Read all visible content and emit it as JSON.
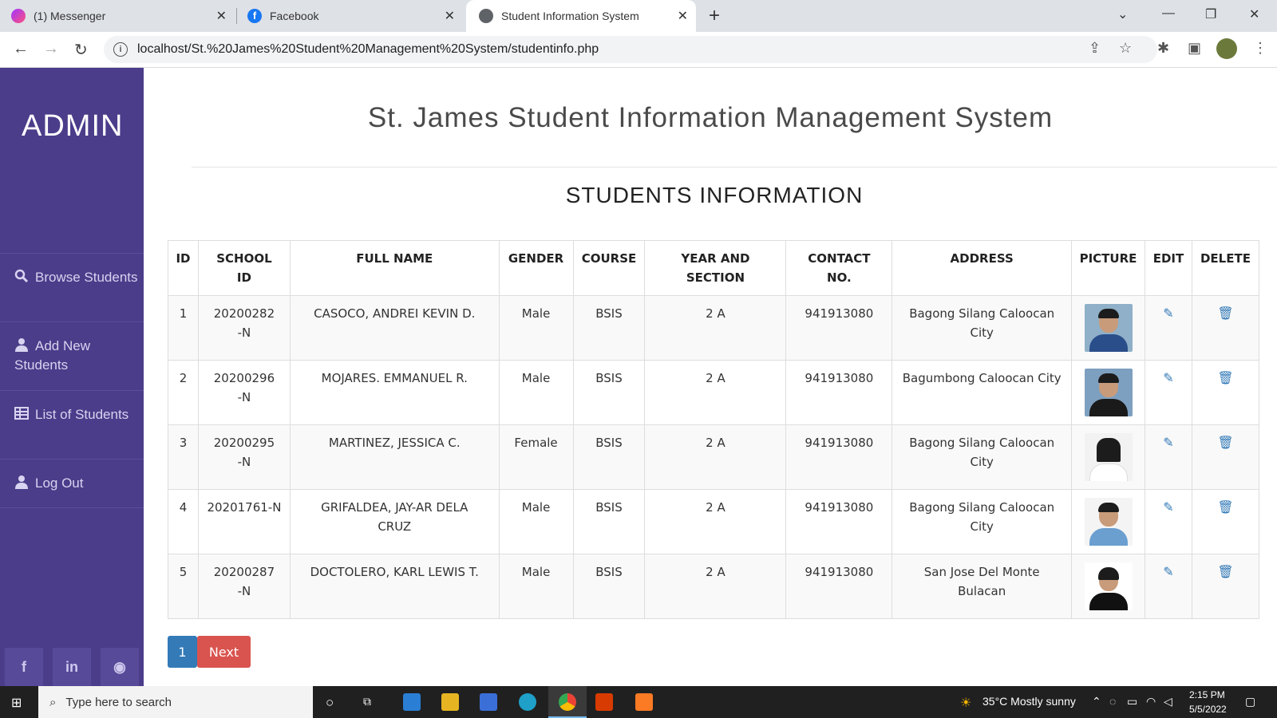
{
  "browser": {
    "tabs": [
      {
        "title": "(1) Messenger",
        "favicon": "messenger-icon"
      },
      {
        "title": "Facebook",
        "favicon": "facebook-icon"
      },
      {
        "title": "Student Information System",
        "favicon": "globe-icon"
      }
    ],
    "url": "localhost/St.%20James%20Student%20Management%20System/studentinfo.php"
  },
  "sidebar": {
    "brand": "ADMIN",
    "items": [
      {
        "label": "Browse Students",
        "icon": "search-icon"
      },
      {
        "label": "Add New Students",
        "icon": "user-icon"
      },
      {
        "label": "List of Students",
        "icon": "table-icon"
      },
      {
        "label": "Log Out",
        "icon": "user-icon"
      }
    ],
    "social": [
      "facebook-icon",
      "linkedin-icon",
      "github-icon"
    ]
  },
  "page": {
    "title": "St. James Student Information Management System",
    "section_title": "STUDENTS INFORMATION"
  },
  "table": {
    "headers": [
      "ID",
      "SCHOOL ID",
      "FULL NAME",
      "GENDER",
      "COURSE",
      "YEAR AND SECTION",
      "CONTACT NO.",
      "ADDRESS",
      "PICTURE",
      "EDIT",
      "DELETE"
    ],
    "rows": [
      {
        "id": "1",
        "school_id": "20200282-N",
        "name": "CASOCO, ANDREI KEVIN D.",
        "gender": "Male",
        "course": "BSIS",
        "section": "2 A",
        "contact": "941913080",
        "address": "Bagong Silang Caloocan City"
      },
      {
        "id": "2",
        "school_id": "20200296-N",
        "name": "MOJARES. EMMANUEL R.",
        "gender": "Male",
        "course": "BSIS",
        "section": "2 A",
        "contact": "941913080",
        "address": "Bagumbong Caloocan City"
      },
      {
        "id": "3",
        "school_id": "20200295-N",
        "name": "MARTINEZ, JESSICA C.",
        "gender": "Female",
        "course": "BSIS",
        "section": "2 A",
        "contact": "941913080",
        "address": "Bagong Silang Caloocan City"
      },
      {
        "id": "4",
        "school_id": "20201761-N",
        "name": "GRIFALDEA, JAY-AR DELA CRUZ",
        "gender": "Male",
        "course": "BSIS",
        "section": "2 A",
        "contact": "941913080",
        "address": "Bagong Silang Caloocan City"
      },
      {
        "id": "5",
        "school_id": "20200287-N",
        "name": "DOCTOLERO, KARL LEWIS T.",
        "gender": "Male",
        "course": "BSIS",
        "section": "2 A",
        "contact": "941913080",
        "address": "San Jose Del Monte Bulacan"
      }
    ]
  },
  "pagination": {
    "current": "1",
    "next": "Next"
  },
  "taskbar": {
    "search_placeholder": "Type here to search",
    "weather": "35°C  Mostly sunny",
    "time": "2:15 PM",
    "date": "5/5/2022"
  },
  "colors": {
    "sidebar": "#4b3d8a",
    "accent_blue": "#337ab7",
    "next_red": "#d9534f"
  }
}
